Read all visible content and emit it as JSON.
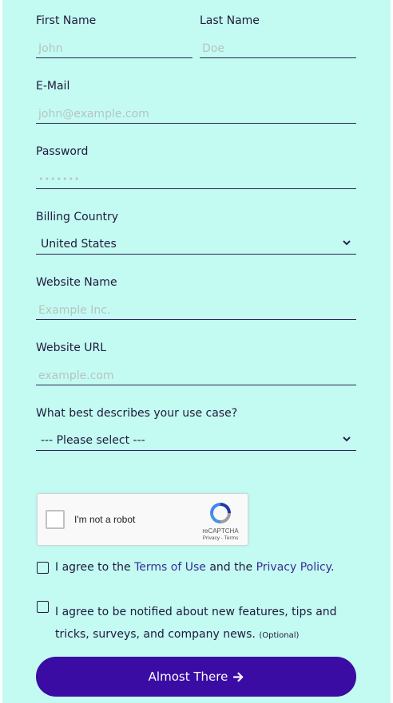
{
  "form": {
    "first_name": {
      "label": "First Name",
      "placeholder": "John"
    },
    "last_name": {
      "label": "Last Name",
      "placeholder": "Doe"
    },
    "email": {
      "label": "E-Mail",
      "placeholder": "john@example.com"
    },
    "password": {
      "label": "Password",
      "value": "•••••••"
    },
    "billing_country": {
      "label": "Billing Country",
      "value": "United States"
    },
    "website_name": {
      "label": "Website Name",
      "placeholder": "Example Inc."
    },
    "website_url": {
      "label": "Website URL",
      "placeholder": "example.com"
    },
    "use_case": {
      "label": "What best describes your use case?",
      "value": "--- Please select ---"
    }
  },
  "recaptcha": {
    "label": "I'm not a robot",
    "brand": "reCAPTCHA",
    "links": "Privacy - Terms"
  },
  "terms": {
    "prefix": "I agree to the ",
    "terms_link": "Terms of Use",
    "middle": " and the ",
    "privacy_link": "Privacy Policy",
    "suffix": "."
  },
  "newsletter": {
    "line1": "I agree to be notified about new features, tips and",
    "line2": "tricks, surveys, and company news.",
    "optional": "(Optional)"
  },
  "submit": {
    "label": "Almost There"
  },
  "colors": {
    "background": "#c3fbf2",
    "button": "#3a0ca3",
    "text": "#1f1a3d",
    "link": "#3a2d9a"
  }
}
